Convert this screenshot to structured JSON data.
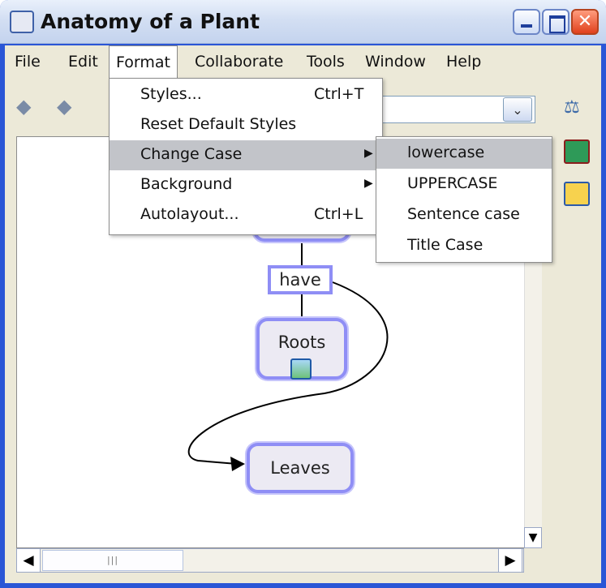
{
  "window": {
    "title": "Anatomy of a Plant"
  },
  "menubar": [
    "File",
    "Edit",
    "Format",
    "Collaborate",
    "Tools",
    "Window",
    "Help"
  ],
  "format_menu": {
    "items": [
      {
        "label": "Styles...",
        "shortcut": "Ctrl+T"
      },
      {
        "label": "Reset Default Styles",
        "shortcut": ""
      },
      {
        "label": "Change Case",
        "shortcut": ""
      },
      {
        "label": "Background",
        "shortcut": ""
      },
      {
        "label": "Autolayout...",
        "shortcut": "Ctrl+L"
      }
    ],
    "highlighted": "Change Case"
  },
  "change_case_menu": {
    "items": [
      "lowercase",
      "UPPERCASE",
      "Sentence case",
      "Title Case"
    ],
    "highlighted": "lowercase"
  },
  "map": {
    "link_label": "have",
    "nodes": [
      "Roots",
      "Leaves"
    ]
  },
  "colors": {
    "node_border": "#8f8ef5",
    "titlebar": "#d3dff3",
    "menubar": "#ece9d8",
    "highlight": "#c2c4c9"
  },
  "icons": [
    "app-icon",
    "back-arrow-icon",
    "forward-arrow-icon",
    "dropdown-chevron-icon",
    "tool-icon",
    "list-icon",
    "collaborate-icon",
    "image-icon",
    "submenu-arrow-icon"
  ]
}
